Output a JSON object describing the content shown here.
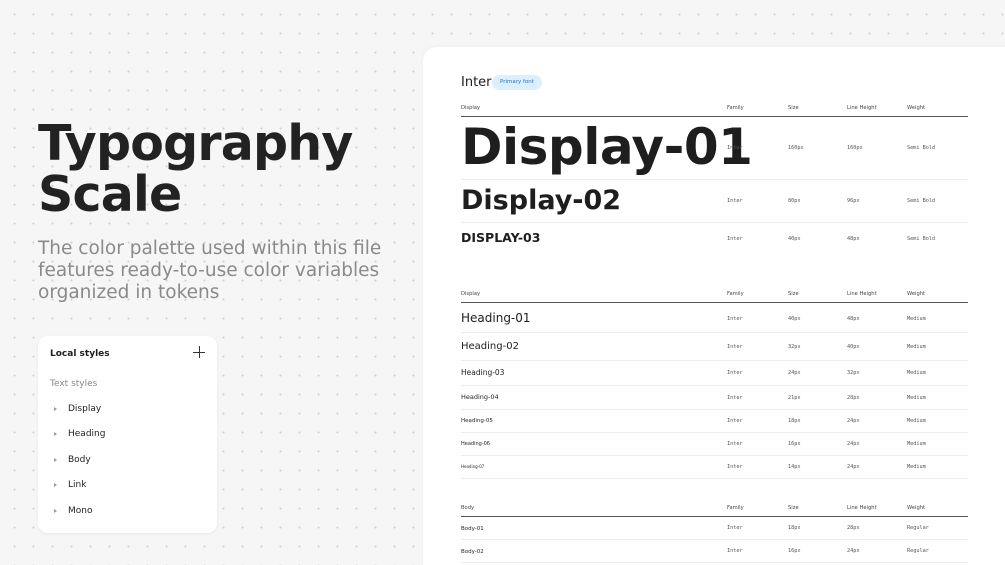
{
  "hero": {
    "title": "Typography\nScale",
    "subtitle": "The color palette used within this file features ready-to-use color variables organized in tokens"
  },
  "panel": {
    "title": "Local styles",
    "add_icon": "plus-icon",
    "section": "Text styles",
    "items": [
      "Display",
      "Heading",
      "Body",
      "Link",
      "Mono"
    ]
  },
  "sheet": {
    "font": "Inter",
    "badge": "Primary font",
    "display": {
      "headers": [
        "Display",
        "Family",
        "Size",
        "Line Height",
        "Weight"
      ],
      "rows": [
        [
          "Display-01",
          "Inter",
          "160px",
          "160px",
          "Semi Bold"
        ],
        [
          "Display-02",
          "Inter",
          "80px",
          "96px",
          "Semi Bold"
        ],
        [
          "DISPLAY-03",
          "Inter",
          "40px",
          "48px",
          "Semi Bold"
        ]
      ]
    },
    "heading": {
      "headers": [
        "Display",
        "Family",
        "Size",
        "Line Height",
        "Weight"
      ],
      "rows": [
        [
          "Heading-01",
          "Inter",
          "40px",
          "48px",
          "Medium"
        ],
        [
          "Heading-02",
          "Inter",
          "32px",
          "40px",
          "Medium"
        ],
        [
          "Heading-03",
          "Inter",
          "24px",
          "32px",
          "Medium"
        ],
        [
          "Heading-04",
          "Inter",
          "21px",
          "28px",
          "Medium"
        ],
        [
          "Heading-05",
          "Inter",
          "18px",
          "24px",
          "Medium"
        ],
        [
          "Heading-06",
          "Inter",
          "16px",
          "24px",
          "Medium"
        ],
        [
          "Heading-07",
          "Inter",
          "14px",
          "24px",
          "Medium"
        ]
      ]
    },
    "body": {
      "headers": [
        "Body",
        "Family",
        "Size",
        "Line Height",
        "Weight"
      ],
      "rows": [
        [
          "Body-01",
          "Inter",
          "18px",
          "28px",
          "Regular"
        ],
        [
          "Body-02",
          "Inter",
          "16px",
          "24px",
          "Regular"
        ]
      ]
    }
  }
}
